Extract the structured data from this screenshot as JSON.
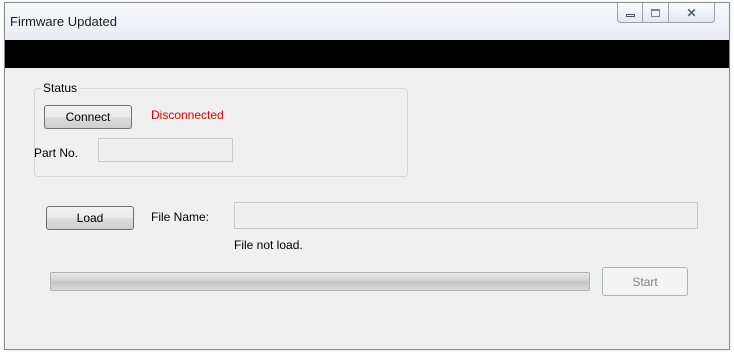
{
  "window": {
    "title": "Firmware Updated",
    "controls": {
      "minimize_icon": "minimize-icon",
      "maximize_icon": "maximize-icon",
      "close_icon": "close-icon",
      "close_glyph": "✕"
    }
  },
  "status_group": {
    "legend": "Status",
    "connect_label": "Connect",
    "connection_state": "Disconnected",
    "connection_color": "#e00000",
    "part_no_label": "Part No.",
    "part_no_value": ""
  },
  "file_section": {
    "load_label": "Load",
    "file_name_label": "File Name:",
    "file_name_value": "",
    "file_status": "File not load."
  },
  "progress": {
    "value": 0
  },
  "start_label": "Start"
}
